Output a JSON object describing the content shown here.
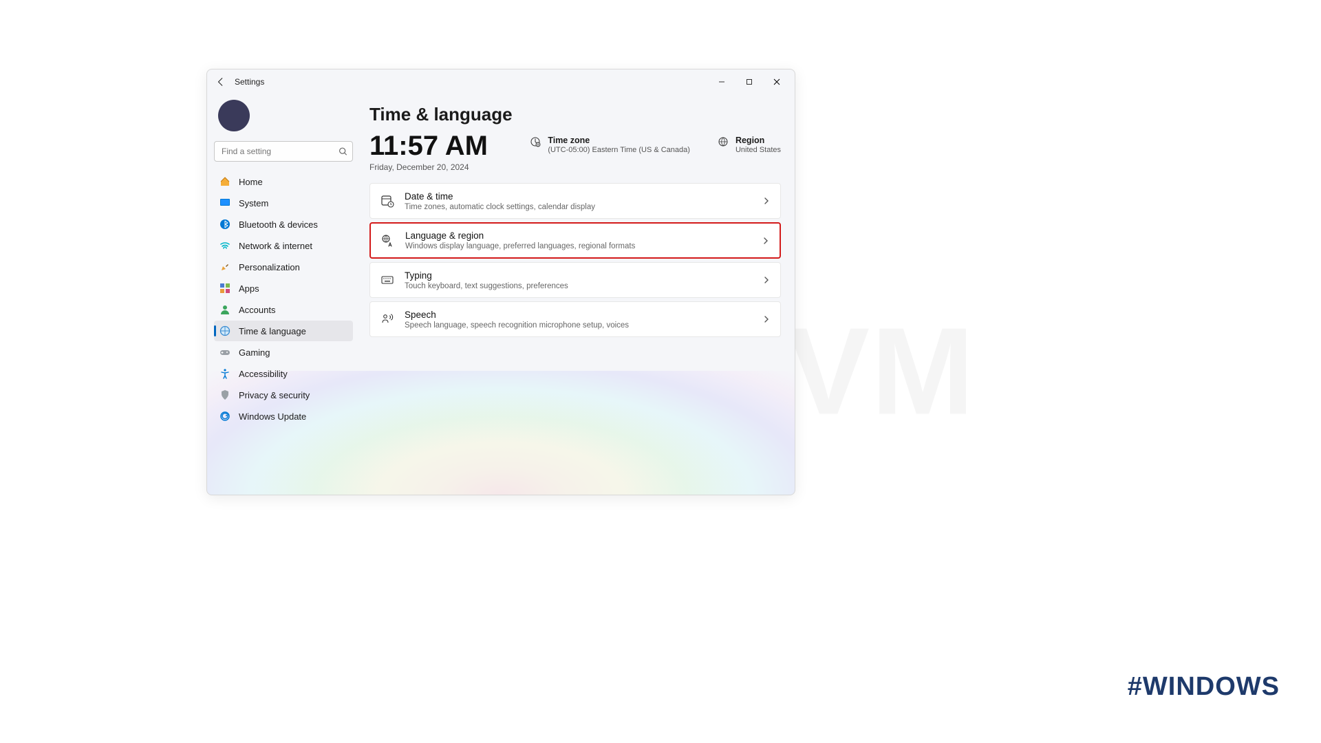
{
  "watermark_text": "NeuronVM",
  "hashtag": "#WINDOWS",
  "app_title": "Settings",
  "search": {
    "placeholder": "Find a setting"
  },
  "sidebar": {
    "items": [
      {
        "label": "Home"
      },
      {
        "label": "System"
      },
      {
        "label": "Bluetooth & devices"
      },
      {
        "label": "Network & internet"
      },
      {
        "label": "Personalization"
      },
      {
        "label": "Apps"
      },
      {
        "label": "Accounts"
      },
      {
        "label": "Time & language"
      },
      {
        "label": "Gaming"
      },
      {
        "label": "Accessibility"
      },
      {
        "label": "Privacy & security"
      },
      {
        "label": "Windows Update"
      }
    ],
    "active_index": 7
  },
  "page": {
    "title": "Time & language",
    "clock": "11:57 AM",
    "date": "Friday, December 20, 2024",
    "timezone": {
      "label": "Time zone",
      "value": "(UTC-05:00) Eastern Time (US & Canada)"
    },
    "region": {
      "label": "Region",
      "value": "United States"
    },
    "cards": [
      {
        "title": "Date & time",
        "desc": "Time zones, automatic clock settings, calendar display"
      },
      {
        "title": "Language & region",
        "desc": "Windows display language, preferred languages, regional formats"
      },
      {
        "title": "Typing",
        "desc": "Touch keyboard, text suggestions, preferences"
      },
      {
        "title": "Speech",
        "desc": "Speech language, speech recognition microphone setup, voices"
      }
    ],
    "highlight_index": 1
  }
}
